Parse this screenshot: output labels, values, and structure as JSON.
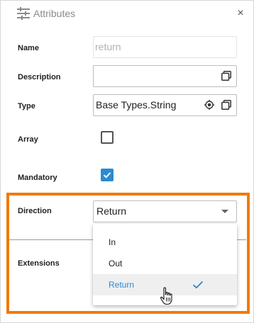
{
  "header": {
    "title": "Attributes",
    "icon": "sliders-icon",
    "close": "×"
  },
  "fields": {
    "name": {
      "label": "Name",
      "value": "return"
    },
    "description": {
      "label": "Description",
      "value": ""
    },
    "type": {
      "label": "Type",
      "value": "Base Types.String"
    },
    "array": {
      "label": "Array",
      "checked": false
    },
    "mandatory": {
      "label": "Mandatory",
      "checked": true
    },
    "direction": {
      "label": "Direction",
      "value": "Return"
    },
    "extensions": {
      "label": "Extensions"
    }
  },
  "dropdown": {
    "options": [
      {
        "label": "In",
        "selected": false
      },
      {
        "label": "Out",
        "selected": false
      },
      {
        "label": "Return",
        "selected": true
      }
    ]
  },
  "colors": {
    "accent": "#2c8ad1",
    "highlight": "#ee7b0b",
    "muted": "#8a8a8a"
  }
}
